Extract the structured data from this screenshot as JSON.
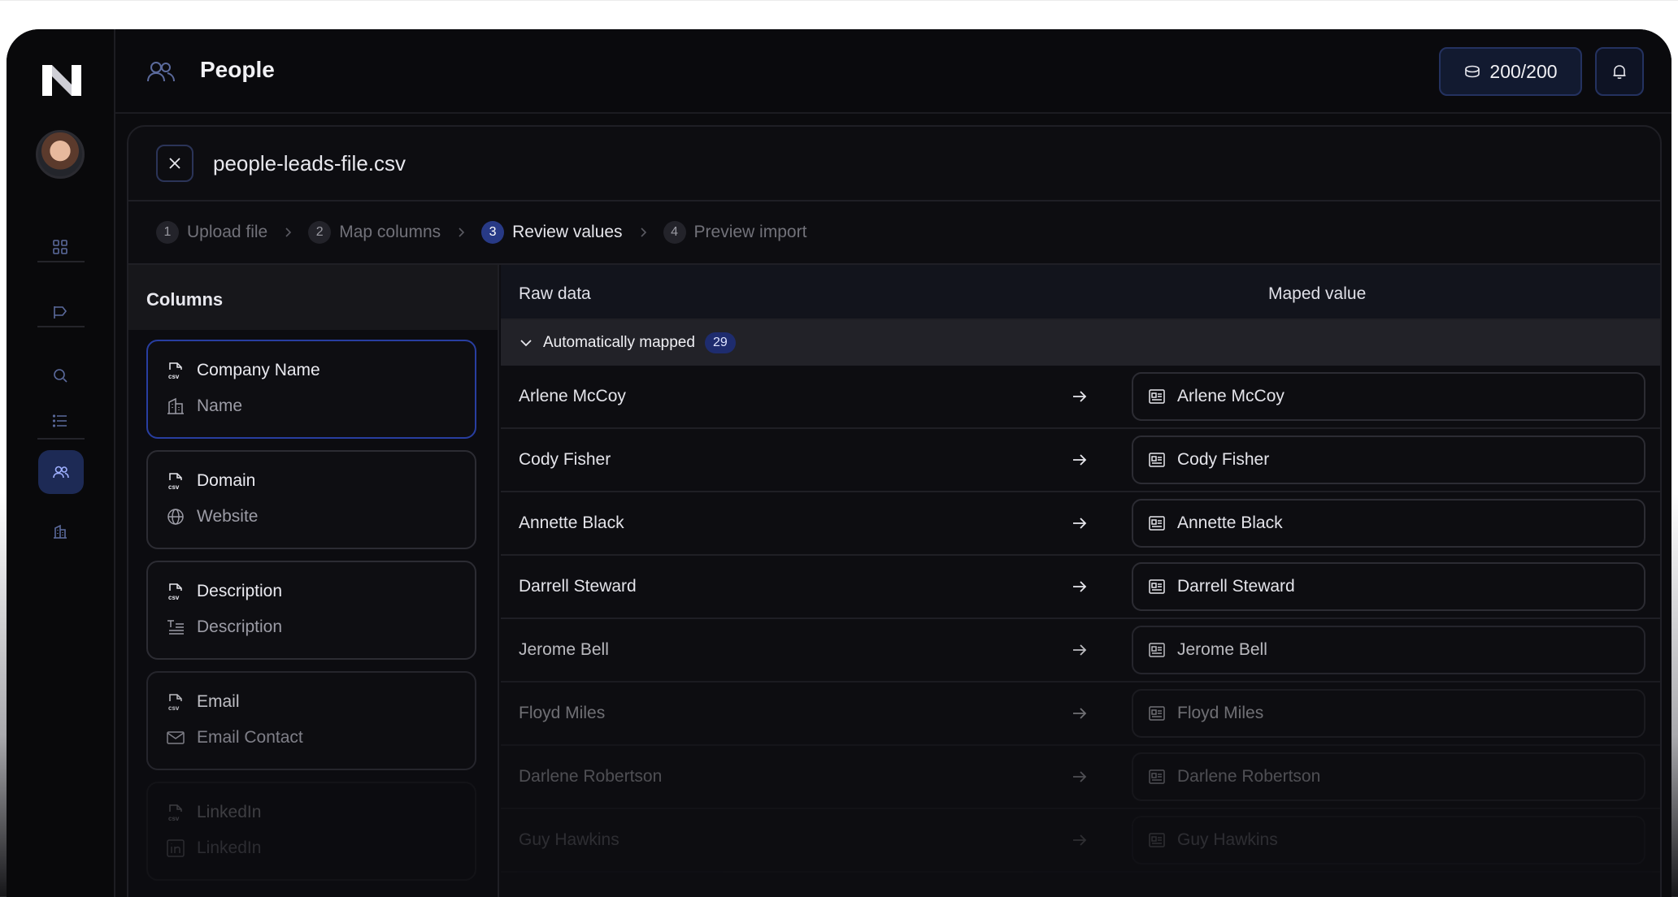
{
  "header": {
    "title": "People",
    "credits": "200/200"
  },
  "panel": {
    "file_name": "people-leads-file.csv"
  },
  "steps": [
    {
      "num": "1",
      "label": "Upload file"
    },
    {
      "num": "2",
      "label": "Map columns"
    },
    {
      "num": "3",
      "label": "Review values"
    },
    {
      "num": "4",
      "label": "Preview import"
    }
  ],
  "columns": {
    "title": "Columns",
    "items": [
      {
        "source": "Company Name",
        "target": "Name"
      },
      {
        "source": "Domain",
        "target": "Website"
      },
      {
        "source": "Description",
        "target": "Description"
      },
      {
        "source": "Email",
        "target": "Email Contact"
      },
      {
        "source": "LinkedIn",
        "target": "LinkedIn"
      }
    ]
  },
  "review": {
    "raw_header": "Raw data",
    "mapped_header": "Maped value",
    "group_label": "Automatically mapped",
    "group_count": "29",
    "rows": [
      {
        "raw": "Arlene McCoy",
        "mapped": "Arlene McCoy"
      },
      {
        "raw": "Cody Fisher",
        "mapped": "Cody Fisher"
      },
      {
        "raw": "Annette Black",
        "mapped": "Annette Black"
      },
      {
        "raw": "Darrell Steward",
        "mapped": "Darrell Steward"
      },
      {
        "raw": "Jerome Bell",
        "mapped": "Jerome Bell"
      },
      {
        "raw": "Floyd Miles",
        "mapped": "Floyd Miles"
      },
      {
        "raw": "Darlene Robertson",
        "mapped": "Darlene Robertson"
      },
      {
        "raw": "Guy Hawkins",
        "mapped": "Guy Hawkins"
      }
    ]
  }
}
